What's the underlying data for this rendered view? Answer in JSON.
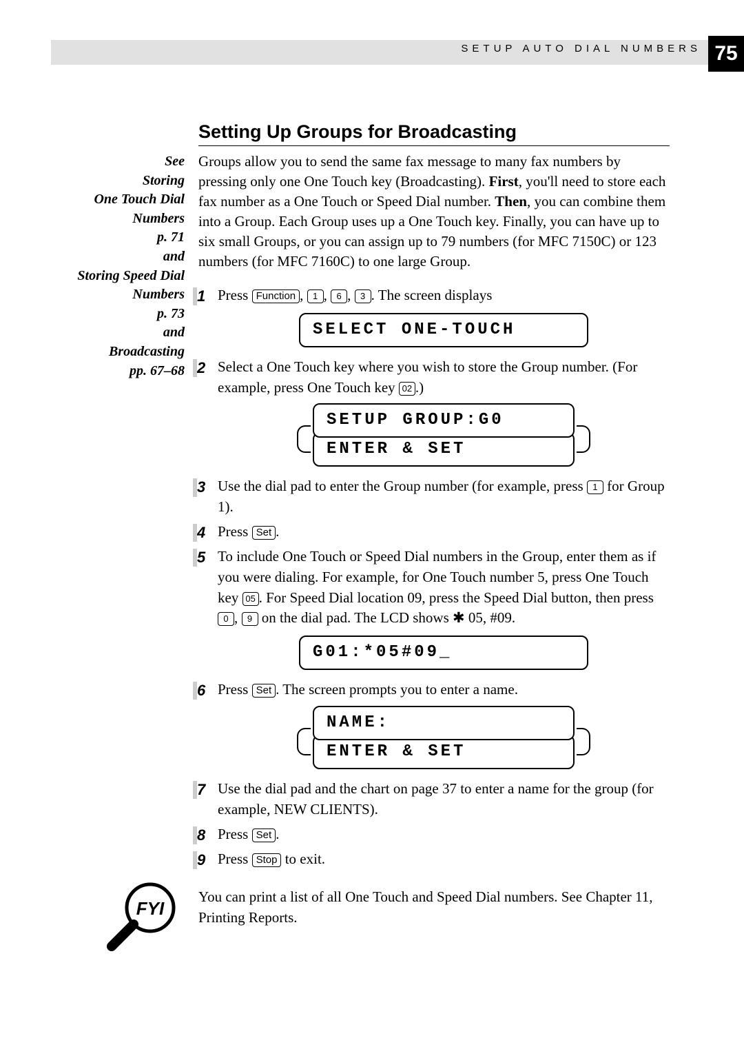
{
  "header": {
    "running_title": "SETUP AUTO DIAL NUMBERS",
    "page_number": "75"
  },
  "sidebar": {
    "lines": [
      "See",
      "Storing",
      "One Touch Dial",
      "Numbers",
      "p. 71",
      "and",
      "Storing Speed Dial",
      "Numbers",
      "p. 73",
      "and",
      "Broadcasting",
      "pp. 67–68"
    ]
  },
  "section": {
    "title": "Setting Up Groups for Broadcasting",
    "intro_pre": "Groups allow you to send the same fax message to many fax numbers by pressing only one One Touch key (Broadcasting).  ",
    "intro_first": "First",
    "intro_mid": ", you'll need to store each fax number as a One Touch or Speed Dial number.  ",
    "intro_then": "Then",
    "intro_post": ", you can combine them into a Group.  Each Group uses up a One Touch key.  Finally, you can have up to six small Groups, or you can assign up to 79 numbers (for MFC 7150C) or 123 numbers (for MFC 7160C) to one large Group."
  },
  "keys": {
    "function": "Function",
    "set": "Set",
    "stop": "Stop",
    "d0": "0",
    "d1": "1",
    "d3": "3",
    "d6": "6",
    "d9": "9",
    "ot02": "02",
    "ot05": "05"
  },
  "steps": {
    "s1_a": "Press ",
    "s1_b": ", ",
    "s1_c": ", ",
    "s1_d": ", ",
    "s1_e": ".  The screen displays",
    "s2_a": "Select a One Touch key where you wish to store the Group number. (For example, press One Touch key ",
    "s2_b": ".)",
    "s3_a": "Use the dial pad to enter the Group number (for example, press ",
    "s3_b": " for Group 1).",
    "s4_a": "Press ",
    "s4_b": ".",
    "s5_a": "To include One Touch or Speed Dial numbers in the Group, enter them as if you were dialing. For example, for One Touch number 5, press One Touch key ",
    "s5_b": ". For Speed Dial location 09, press the Speed Dial button, then press ",
    "s5_c": ", ",
    "s5_d": " on the dial pad. The LCD shows ",
    "s5_e": " 05, #09.",
    "s5_star": "✱",
    "s6_a": "Press ",
    "s6_b": ".  The screen prompts you to enter a name.",
    "s7": "Use the dial pad and the chart on page 37 to enter a name for the group (for example, NEW CLIENTS).",
    "s8_a": "Press ",
    "s8_b": ".",
    "s9_a": "Press ",
    "s9_b": " to exit."
  },
  "lcd": {
    "l1": "SELECT ONE-TOUCH",
    "l2a": "SETUP GROUP:G0",
    "l2b": "ENTER & SET",
    "l3": "G01:*05#09_",
    "l4a": "NAME:",
    "l4b": "ENTER & SET"
  },
  "closing": {
    "text": "You can print a list of all One Touch and Speed Dial numbers.  See Chapter 11, Printing Reports."
  }
}
